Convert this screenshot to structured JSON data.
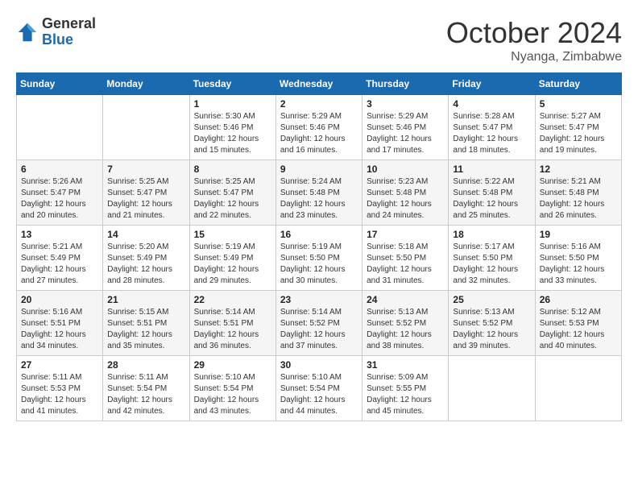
{
  "header": {
    "logo_general": "General",
    "logo_blue": "Blue",
    "month": "October 2024",
    "location": "Nyanga, Zimbabwe"
  },
  "weekdays": [
    "Sunday",
    "Monday",
    "Tuesday",
    "Wednesday",
    "Thursday",
    "Friday",
    "Saturday"
  ],
  "weeks": [
    [
      {
        "day": "",
        "info": ""
      },
      {
        "day": "",
        "info": ""
      },
      {
        "day": "1",
        "info": "Sunrise: 5:30 AM\nSunset: 5:46 PM\nDaylight: 12 hours\nand 15 minutes."
      },
      {
        "day": "2",
        "info": "Sunrise: 5:29 AM\nSunset: 5:46 PM\nDaylight: 12 hours\nand 16 minutes."
      },
      {
        "day": "3",
        "info": "Sunrise: 5:29 AM\nSunset: 5:46 PM\nDaylight: 12 hours\nand 17 minutes."
      },
      {
        "day": "4",
        "info": "Sunrise: 5:28 AM\nSunset: 5:47 PM\nDaylight: 12 hours\nand 18 minutes."
      },
      {
        "day": "5",
        "info": "Sunrise: 5:27 AM\nSunset: 5:47 PM\nDaylight: 12 hours\nand 19 minutes."
      }
    ],
    [
      {
        "day": "6",
        "info": "Sunrise: 5:26 AM\nSunset: 5:47 PM\nDaylight: 12 hours\nand 20 minutes."
      },
      {
        "day": "7",
        "info": "Sunrise: 5:25 AM\nSunset: 5:47 PM\nDaylight: 12 hours\nand 21 minutes."
      },
      {
        "day": "8",
        "info": "Sunrise: 5:25 AM\nSunset: 5:47 PM\nDaylight: 12 hours\nand 22 minutes."
      },
      {
        "day": "9",
        "info": "Sunrise: 5:24 AM\nSunset: 5:48 PM\nDaylight: 12 hours\nand 23 minutes."
      },
      {
        "day": "10",
        "info": "Sunrise: 5:23 AM\nSunset: 5:48 PM\nDaylight: 12 hours\nand 24 minutes."
      },
      {
        "day": "11",
        "info": "Sunrise: 5:22 AM\nSunset: 5:48 PM\nDaylight: 12 hours\nand 25 minutes."
      },
      {
        "day": "12",
        "info": "Sunrise: 5:21 AM\nSunset: 5:48 PM\nDaylight: 12 hours\nand 26 minutes."
      }
    ],
    [
      {
        "day": "13",
        "info": "Sunrise: 5:21 AM\nSunset: 5:49 PM\nDaylight: 12 hours\nand 27 minutes."
      },
      {
        "day": "14",
        "info": "Sunrise: 5:20 AM\nSunset: 5:49 PM\nDaylight: 12 hours\nand 28 minutes."
      },
      {
        "day": "15",
        "info": "Sunrise: 5:19 AM\nSunset: 5:49 PM\nDaylight: 12 hours\nand 29 minutes."
      },
      {
        "day": "16",
        "info": "Sunrise: 5:19 AM\nSunset: 5:50 PM\nDaylight: 12 hours\nand 30 minutes."
      },
      {
        "day": "17",
        "info": "Sunrise: 5:18 AM\nSunset: 5:50 PM\nDaylight: 12 hours\nand 31 minutes."
      },
      {
        "day": "18",
        "info": "Sunrise: 5:17 AM\nSunset: 5:50 PM\nDaylight: 12 hours\nand 32 minutes."
      },
      {
        "day": "19",
        "info": "Sunrise: 5:16 AM\nSunset: 5:50 PM\nDaylight: 12 hours\nand 33 minutes."
      }
    ],
    [
      {
        "day": "20",
        "info": "Sunrise: 5:16 AM\nSunset: 5:51 PM\nDaylight: 12 hours\nand 34 minutes."
      },
      {
        "day": "21",
        "info": "Sunrise: 5:15 AM\nSunset: 5:51 PM\nDaylight: 12 hours\nand 35 minutes."
      },
      {
        "day": "22",
        "info": "Sunrise: 5:14 AM\nSunset: 5:51 PM\nDaylight: 12 hours\nand 36 minutes."
      },
      {
        "day": "23",
        "info": "Sunrise: 5:14 AM\nSunset: 5:52 PM\nDaylight: 12 hours\nand 37 minutes."
      },
      {
        "day": "24",
        "info": "Sunrise: 5:13 AM\nSunset: 5:52 PM\nDaylight: 12 hours\nand 38 minutes."
      },
      {
        "day": "25",
        "info": "Sunrise: 5:13 AM\nSunset: 5:52 PM\nDaylight: 12 hours\nand 39 minutes."
      },
      {
        "day": "26",
        "info": "Sunrise: 5:12 AM\nSunset: 5:53 PM\nDaylight: 12 hours\nand 40 minutes."
      }
    ],
    [
      {
        "day": "27",
        "info": "Sunrise: 5:11 AM\nSunset: 5:53 PM\nDaylight: 12 hours\nand 41 minutes."
      },
      {
        "day": "28",
        "info": "Sunrise: 5:11 AM\nSunset: 5:54 PM\nDaylight: 12 hours\nand 42 minutes."
      },
      {
        "day": "29",
        "info": "Sunrise: 5:10 AM\nSunset: 5:54 PM\nDaylight: 12 hours\nand 43 minutes."
      },
      {
        "day": "30",
        "info": "Sunrise: 5:10 AM\nSunset: 5:54 PM\nDaylight: 12 hours\nand 44 minutes."
      },
      {
        "day": "31",
        "info": "Sunrise: 5:09 AM\nSunset: 5:55 PM\nDaylight: 12 hours\nand 45 minutes."
      },
      {
        "day": "",
        "info": ""
      },
      {
        "day": "",
        "info": ""
      }
    ]
  ]
}
